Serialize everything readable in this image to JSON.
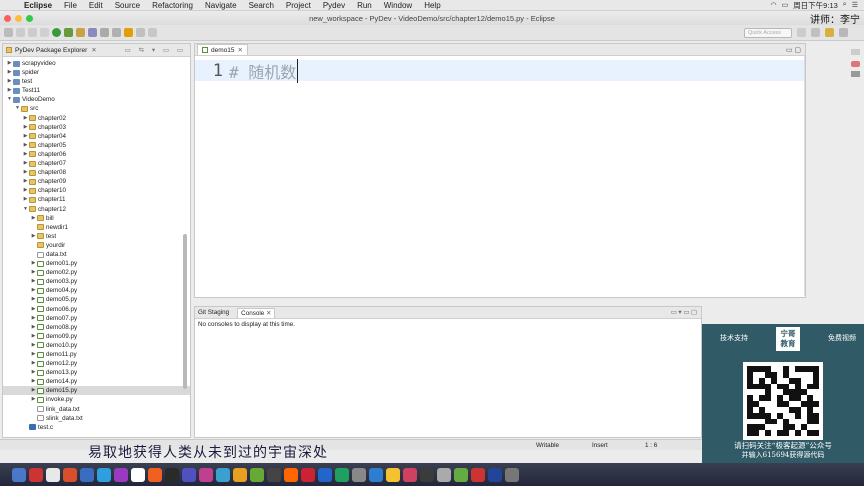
{
  "menubar": {
    "app": "Eclipse",
    "items": [
      "File",
      "Edit",
      "Source",
      "Refactoring",
      "Navigate",
      "Search",
      "Project",
      "Pydev",
      "Run",
      "Window",
      "Help"
    ],
    "clock": "周日下午9:13"
  },
  "window": {
    "title": "new_workspace - PyDev - VideoDemo/src/chapter12/demo15.py - Eclipse",
    "author": "讲师：李宁"
  },
  "toolbar": {
    "quick_access_placeholder": "Quick Access"
  },
  "explorer": {
    "tab_label": "PyDev Package Explorer",
    "tree": [
      {
        "label": "scrapyvideo",
        "depth": 0,
        "kind": "proj",
        "arrow": "▶"
      },
      {
        "label": "spider",
        "depth": 0,
        "kind": "proj",
        "arrow": "▶"
      },
      {
        "label": "test",
        "depth": 0,
        "kind": "proj",
        "arrow": "▶"
      },
      {
        "label": "Test11",
        "depth": 0,
        "kind": "proj",
        "arrow": "▶"
      },
      {
        "label": "VideoDemo",
        "depth": 0,
        "kind": "proj",
        "arrow": "▼"
      },
      {
        "label": "src",
        "depth": 1,
        "kind": "pkg",
        "arrow": "▼"
      },
      {
        "label": "chapter02",
        "depth": 2,
        "kind": "pkg",
        "arrow": "▶"
      },
      {
        "label": "chapter03",
        "depth": 2,
        "kind": "pkg",
        "arrow": "▶"
      },
      {
        "label": "chapter04",
        "depth": 2,
        "kind": "pkg",
        "arrow": "▶"
      },
      {
        "label": "chapter05",
        "depth": 2,
        "kind": "pkg",
        "arrow": "▶"
      },
      {
        "label": "chapter06",
        "depth": 2,
        "kind": "pkg",
        "arrow": "▶"
      },
      {
        "label": "chapter07",
        "depth": 2,
        "kind": "pkg",
        "arrow": "▶"
      },
      {
        "label": "chapter08",
        "depth": 2,
        "kind": "pkg",
        "arrow": "▶"
      },
      {
        "label": "chapter09",
        "depth": 2,
        "kind": "pkg",
        "arrow": "▶"
      },
      {
        "label": "chapter10",
        "depth": 2,
        "kind": "pkg",
        "arrow": "▶"
      },
      {
        "label": "chapter11",
        "depth": 2,
        "kind": "pkg",
        "arrow": "▶"
      },
      {
        "label": "chapter12",
        "depth": 2,
        "kind": "pkg",
        "arrow": "▼"
      },
      {
        "label": "bill",
        "depth": 3,
        "kind": "pkg",
        "arrow": "▶"
      },
      {
        "label": "newdir1",
        "depth": 3,
        "kind": "pkg",
        "arrow": ""
      },
      {
        "label": "test",
        "depth": 3,
        "kind": "pkg",
        "arrow": "▶"
      },
      {
        "label": "yourdir",
        "depth": 3,
        "kind": "pkg",
        "arrow": ""
      },
      {
        "label": "data.txt",
        "depth": 3,
        "kind": "file",
        "arrow": ""
      },
      {
        "label": "demo01.py",
        "depth": 3,
        "kind": "py",
        "arrow": "▶"
      },
      {
        "label": "demo02.py",
        "depth": 3,
        "kind": "py",
        "arrow": "▶"
      },
      {
        "label": "demo03.py",
        "depth": 3,
        "kind": "py",
        "arrow": "▶"
      },
      {
        "label": "demo04.py",
        "depth": 3,
        "kind": "py",
        "arrow": "▶"
      },
      {
        "label": "demo05.py",
        "depth": 3,
        "kind": "py",
        "arrow": "▶"
      },
      {
        "label": "demo06.py",
        "depth": 3,
        "kind": "py",
        "arrow": "▶"
      },
      {
        "label": "demo07.py",
        "depth": 3,
        "kind": "py",
        "arrow": "▶"
      },
      {
        "label": "demo08.py",
        "depth": 3,
        "kind": "py",
        "arrow": "▶"
      },
      {
        "label": "demo09.py",
        "depth": 3,
        "kind": "py",
        "arrow": "▶"
      },
      {
        "label": "demo10.py",
        "depth": 3,
        "kind": "py",
        "arrow": "▶"
      },
      {
        "label": "demo11.py",
        "depth": 3,
        "kind": "py",
        "arrow": "▶"
      },
      {
        "label": "demo12.py",
        "depth": 3,
        "kind": "py",
        "arrow": "▶"
      },
      {
        "label": "demo13.py",
        "depth": 3,
        "kind": "py",
        "arrow": "▶"
      },
      {
        "label": "demo14.py",
        "depth": 3,
        "kind": "py",
        "arrow": "▶"
      },
      {
        "label": "demo15.py",
        "depth": 3,
        "kind": "py",
        "arrow": "▶",
        "selected": true
      },
      {
        "label": "invoke.py",
        "depth": 3,
        "kind": "py",
        "arrow": "▶"
      },
      {
        "label": "link_data.txt",
        "depth": 3,
        "kind": "file",
        "arrow": ""
      },
      {
        "label": "slink_data.txt",
        "depth": 3,
        "kind": "file",
        "arrow": ""
      },
      {
        "label": "test.c",
        "depth": 2,
        "kind": "c",
        "arrow": ""
      }
    ]
  },
  "editor": {
    "tab_label": "demo15",
    "line_number": "1",
    "code": "# 随机数"
  },
  "console": {
    "tabs": [
      "Git Staging",
      "Console"
    ],
    "message": "No consoles to display at this time."
  },
  "statusbar": {
    "mode": "Writable",
    "insert": "Insert",
    "position": "1 : 6"
  },
  "promo": {
    "left": "技术支持",
    "logo_line1": "宁哥",
    "logo_line2": "教育",
    "right": "免费视频",
    "line1": "请扫码关注“极客起源”公众号",
    "line2": "并输入615694获得源代码"
  },
  "subtitle": "易取地获得人类从未到过的宇宙深处",
  "colors": {
    "accent": "#2f5a66",
    "selection": "#d9d9d9",
    "current_line": "#e8f2fe"
  }
}
